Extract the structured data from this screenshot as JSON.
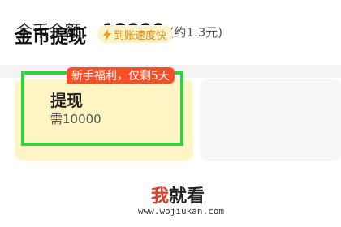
{
  "balance": {
    "label": "金币余额：",
    "value": "12990",
    "approx": "(约1.3元)"
  },
  "withdraw": {
    "title": "金币提现",
    "speed_badge": {
      "icon": "lightning-bolt-icon",
      "text": "到账速度快"
    },
    "options": [
      {
        "title": "提现",
        "subtitle": "需10000",
        "promo": "新手福利，仅剩5天",
        "selected": true
      }
    ]
  },
  "watermark": {
    "logo_part1": "我",
    "logo_part2": "就看",
    "url": "www.wojiukan.com"
  },
  "colors": {
    "accent_orange": "#ff4d25",
    "selection_green": "#2fd43a",
    "option_bg": "#fff5c4",
    "badge_text": "#e08a00"
  }
}
